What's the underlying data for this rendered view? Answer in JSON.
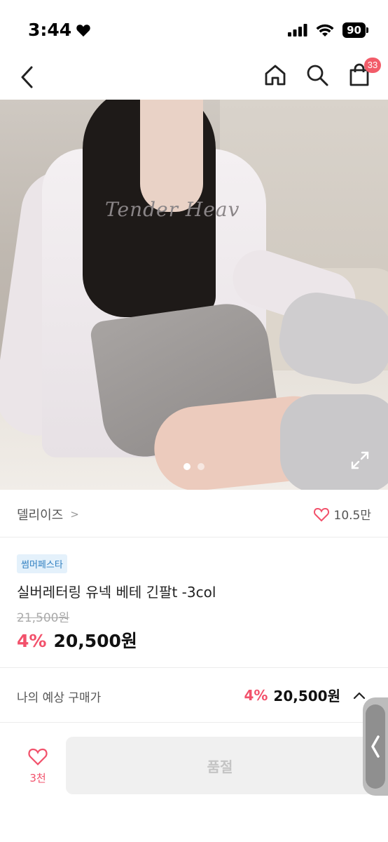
{
  "status_bar": {
    "time": "3:44",
    "battery": "90"
  },
  "header": {
    "cart_count": "33"
  },
  "gallery": {
    "image_text": "Tender Heav",
    "page_count": 2,
    "active_page": 1
  },
  "brand": {
    "name": "델리이즈",
    "chevron": ">",
    "like_count": "10.5만"
  },
  "product": {
    "badge": "썸머페스타",
    "title": "실버레터링 유넥 베테 긴팔t  -3col",
    "original_price": "21,500원",
    "discount": "4%",
    "price": "20,500원"
  },
  "expected": {
    "label": "나의 예상 구매가",
    "discount": "4%",
    "price": "20,500원"
  },
  "bottom": {
    "wish_count": "3천",
    "soldout_label": "품절"
  },
  "colors": {
    "accent": "#f2516b",
    "badge_bg": "#e4f1fb",
    "badge_text": "#2f7fc1",
    "cart_badge": "#f25c69"
  },
  "icons": [
    "heart-filled-icon",
    "back-chevron-icon",
    "home-icon",
    "search-icon",
    "shopping-bag-icon",
    "expand-icon",
    "heart-outline-icon",
    "chevron-up-icon",
    "side-chevron-icon"
  ]
}
